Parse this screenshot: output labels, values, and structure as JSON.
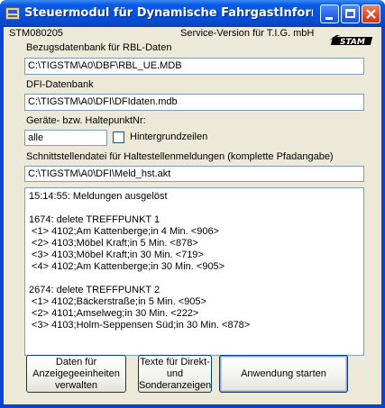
{
  "window": {
    "title": "Steuermodul für Dynamische FahrgastInformation..."
  },
  "header": {
    "code": "STM080205",
    "version": "Service-Version für T.I.G. mbH",
    "logo_text": "STAM"
  },
  "fields": {
    "rbl_label": "Bezugsdatenbank für RBL-Daten",
    "rbl_value": "C:\\TIGSTM\\A0\\DBF\\RBL_UE.MDB",
    "dfi_label": "DFI-Datenbank",
    "dfi_value": "C:\\TIGSTM\\A0\\DFI\\DFIdaten.mdb",
    "geraete_label": "Geräte- bzw. HaltepunktNr:",
    "geraete_value": "alle",
    "hintergrund_label": "Hintergrundzeilen",
    "schnitt_label": "Schnittstellendatei für Haltestellenmeldungen (komplette Pfadangabe)",
    "schnitt_value": "C:\\TIGSTM\\A0\\DFI\\Meld_hst.akt"
  },
  "log": {
    "lines": [
      "15:14:55: Meldungen ausgelöst",
      "",
      "1674: delete TREFFPUNKT 1",
      " <1> 4102;Am Kattenberge;in 4 Min. <906>",
      " <2> 4103;Möbel Kraft;in 5 Min. <878>",
      " <3> 4103;Möbel Kraft;in 30 Min. <719>",
      " <4> 4102;Am Kattenberge;in 30 Min. <905>",
      "",
      "2674: delete TREFFPUNKT 2",
      " <1> 4102;Bäckerstraße;in 5 Min. <905>",
      " <2> 4101;Amselweg;in 30 Min. <222>",
      " <3> 4103;Holm-Seppensen Süd;in 30 Min. <878>"
    ]
  },
  "buttons": {
    "daten_label": "Daten für Anzeigegeeinheiten verwalten",
    "texte_label": "Texte für Direkt- und Sonderanzeigen",
    "start_label": "Anwendung starten"
  }
}
